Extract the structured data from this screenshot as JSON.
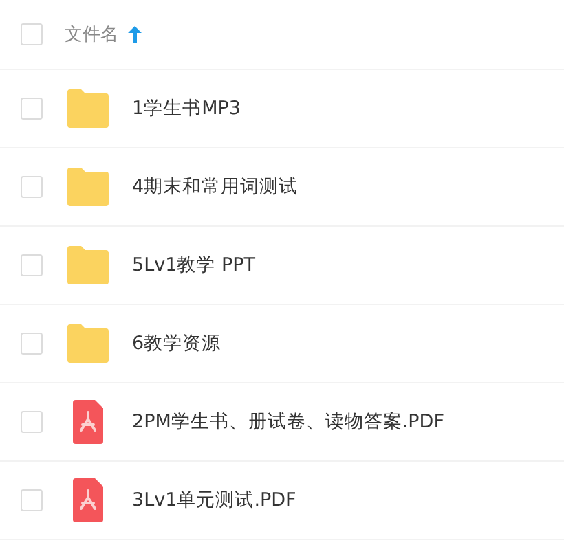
{
  "header": {
    "label": "文件名",
    "checked": false
  },
  "files": [
    {
      "name": "1学生书MP3",
      "kind": "folder",
      "checked": false
    },
    {
      "name": "4期末和常用词测试",
      "kind": "folder",
      "checked": false
    },
    {
      "name": "5Lv1教学 PPT",
      "kind": "folder",
      "checked": false
    },
    {
      "name": "6教学资源",
      "kind": "folder",
      "checked": false
    },
    {
      "name": "2PM学生书、册试卷、读物答案.PDF",
      "kind": "pdf",
      "checked": false
    },
    {
      "name": "3Lv1单元测试.PDF",
      "kind": "pdf",
      "checked": false
    }
  ]
}
